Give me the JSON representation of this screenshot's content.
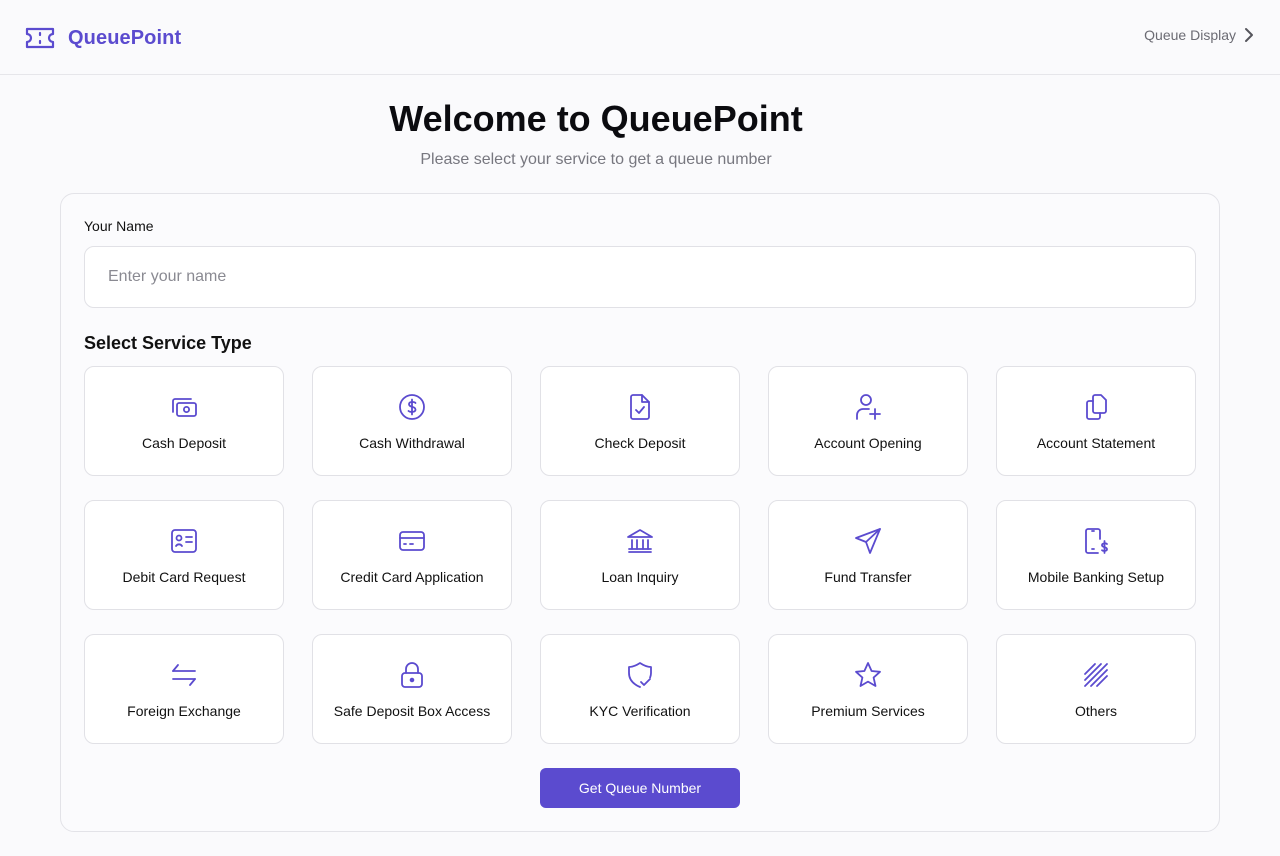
{
  "header": {
    "brand_name": "QueuePoint",
    "brand_icon": "ticket-icon",
    "queue_display_label": "Queue Display",
    "queue_display_icon": "chevron-right-icon"
  },
  "hero": {
    "title": "Welcome to QueuePoint",
    "subtitle": "Please select your service to get a queue number"
  },
  "form": {
    "name_label": "Your Name",
    "name_placeholder": "Enter your name",
    "name_value": "",
    "service_heading": "Select Service Type",
    "services": [
      {
        "label": "Cash Deposit",
        "icon": "banknote-icon"
      },
      {
        "label": "Cash Withdrawal",
        "icon": "dollar-circle-icon"
      },
      {
        "label": "Check Deposit",
        "icon": "file-check-icon"
      },
      {
        "label": "Account Opening",
        "icon": "user-plus-icon"
      },
      {
        "label": "Account Statement",
        "icon": "files-icon"
      },
      {
        "label": "Debit Card Request",
        "icon": "id-card-icon"
      },
      {
        "label": "Credit Card Application",
        "icon": "credit-card-icon"
      },
      {
        "label": "Loan Inquiry",
        "icon": "bank-icon"
      },
      {
        "label": "Fund Transfer",
        "icon": "send-icon"
      },
      {
        "label": "Mobile Banking Setup",
        "icon": "phone-dollar-icon"
      },
      {
        "label": "Foreign Exchange",
        "icon": "arrows-exchange-icon"
      },
      {
        "label": "Safe Deposit Box Access",
        "icon": "lock-icon"
      },
      {
        "label": "KYC Verification",
        "icon": "shield-check-icon"
      },
      {
        "label": "Premium Services",
        "icon": "star-icon"
      },
      {
        "label": "Others",
        "icon": "stripes-icon"
      }
    ],
    "submit_label": "Get Queue Number"
  },
  "colors": {
    "accent": "#5b4bcf",
    "background": "#fafafc",
    "border": "#e1e1e6",
    "muted_text": "#77777f"
  }
}
